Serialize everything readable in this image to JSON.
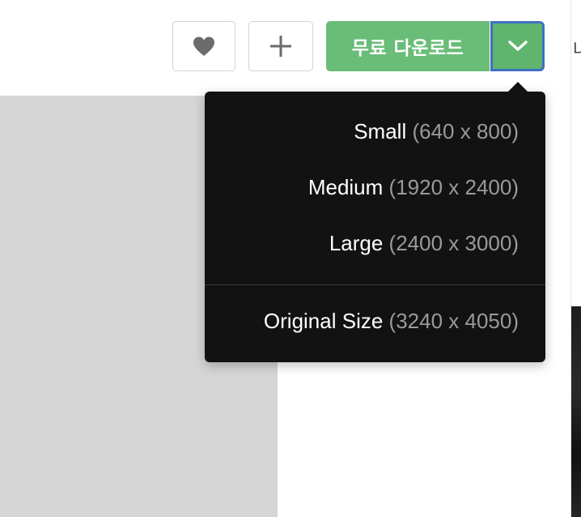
{
  "toolbar": {
    "like_icon": "heart-icon",
    "collect_icon": "plus-icon",
    "download_label": "무료 다운로드",
    "caret_icon": "chevron-down-icon",
    "colors": {
      "download_bg": "#6abd78",
      "caret_border": "#3f6fc3",
      "icon_gray": "#6b6b6b"
    }
  },
  "download_menu": {
    "items": [
      {
        "name": "Small",
        "dims": "(640 x 800)"
      },
      {
        "name": "Medium",
        "dims": "(1920 x 2400)"
      },
      {
        "name": "Large",
        "dims": "(2400 x 3000)"
      },
      {
        "name": "Original Size",
        "dims": "(3240 x 4050)"
      }
    ],
    "colors": {
      "background": "#121212",
      "name_text": "#ffffff",
      "dims_text": "#9a9a9a"
    }
  },
  "right_edge": {
    "partial_text": "나"
  }
}
